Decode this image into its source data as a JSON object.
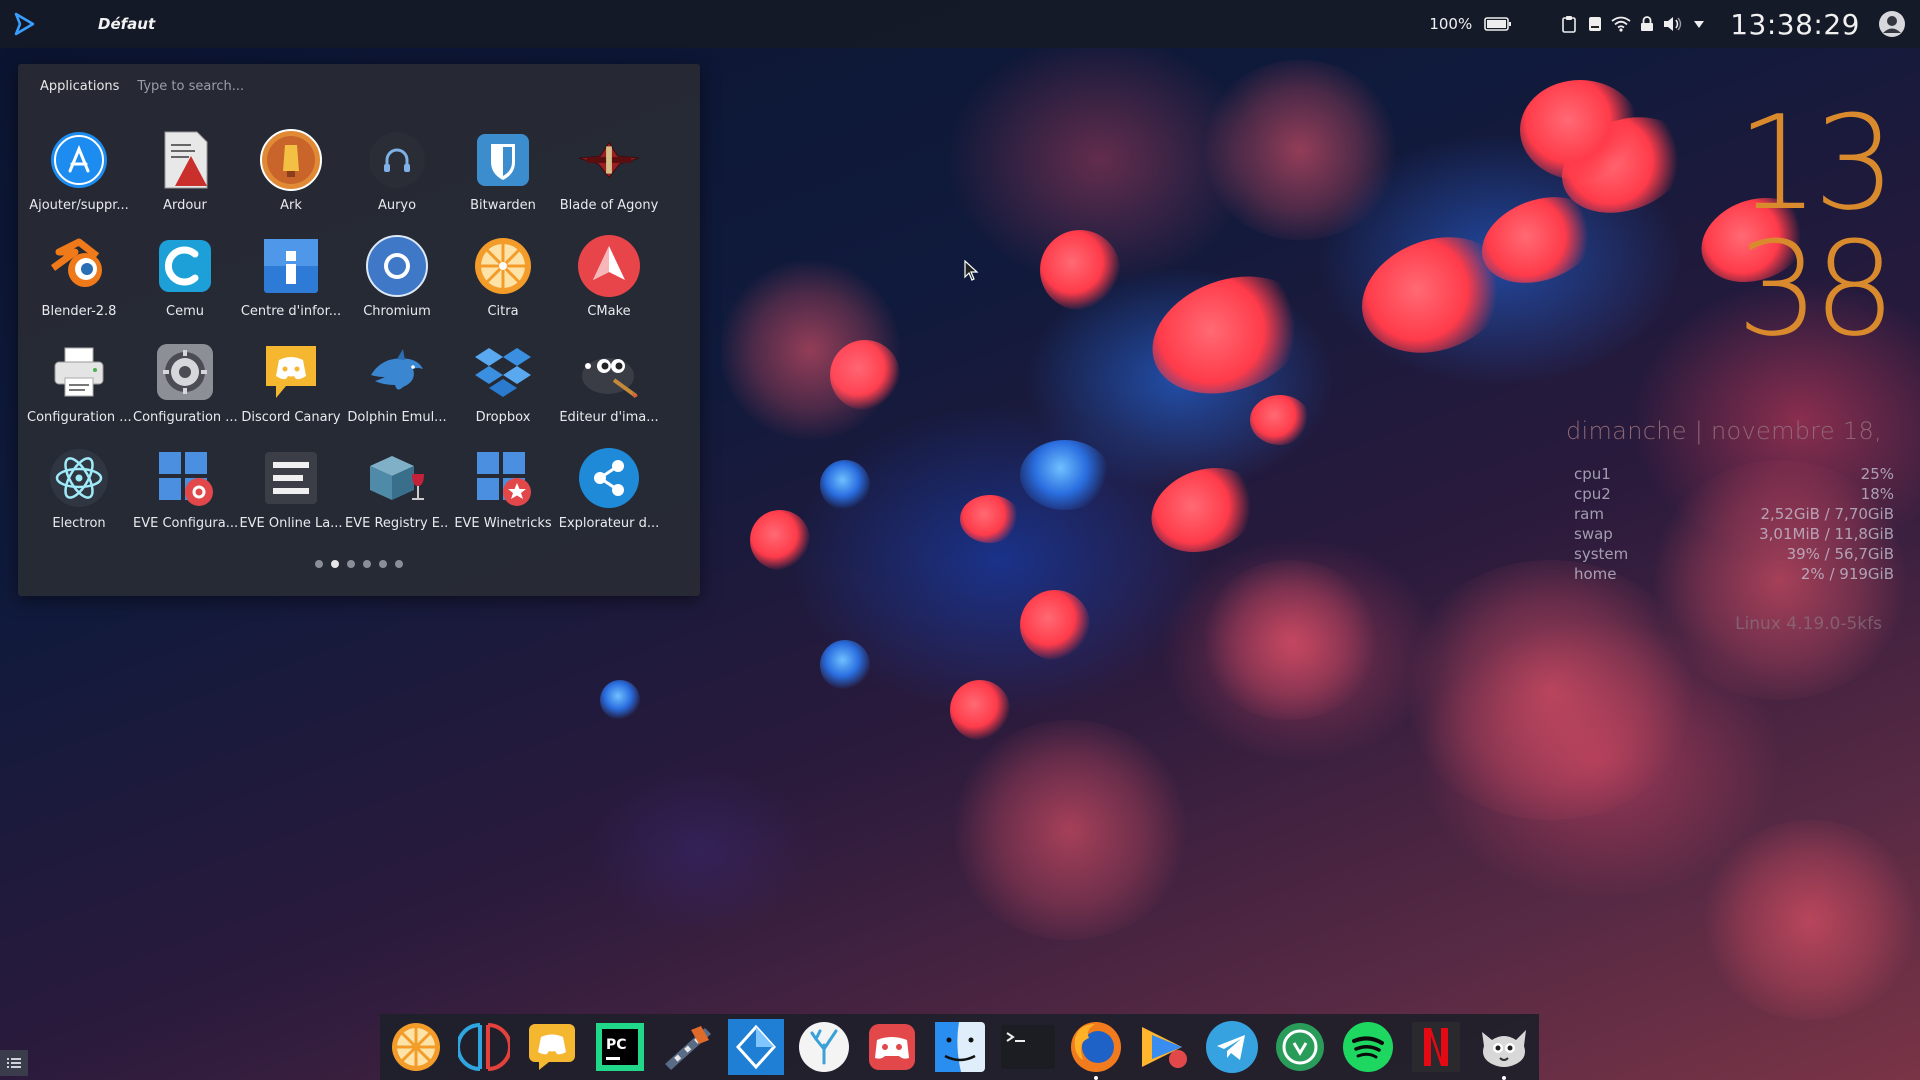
{
  "top_panel": {
    "activity_label": "Défaut",
    "battery_percent": "100%",
    "time": "13:38:29",
    "tray_icons": [
      "battery-icon",
      "clipboard-icon",
      "drive-icon",
      "wifi-icon",
      "lock-icon",
      "volume-icon",
      "tray-expand-icon"
    ]
  },
  "app_menu": {
    "tab_label": "Applications",
    "search_placeholder": "Type to search...",
    "apps": [
      {
        "label": "Ajouter/suppr...",
        "icon": "appstore-icon"
      },
      {
        "label": "Ardour",
        "icon": "ardour-icon"
      },
      {
        "label": "Ark",
        "icon": "ark-icon"
      },
      {
        "label": "Auryo",
        "icon": "auryo-icon"
      },
      {
        "label": "Bitwarden",
        "icon": "bitwarden-icon"
      },
      {
        "label": "Blade of Agony",
        "icon": "blade-of-agony-icon"
      },
      {
        "label": "Blender-2.8",
        "icon": "blender-icon"
      },
      {
        "label": "Cemu",
        "icon": "cemu-icon"
      },
      {
        "label": "Centre d'infor...",
        "icon": "info-center-icon"
      },
      {
        "label": "Chromium",
        "icon": "chromium-icon"
      },
      {
        "label": "Citra",
        "icon": "citra-icon"
      },
      {
        "label": "CMake",
        "icon": "cmake-icon"
      },
      {
        "label": "Configuration ...",
        "icon": "printer-icon"
      },
      {
        "label": "Configuration ...",
        "icon": "settings-icon"
      },
      {
        "label": "Discord Canary",
        "icon": "discord-canary-icon"
      },
      {
        "label": "Dolphin Emul...",
        "icon": "dolphin-icon"
      },
      {
        "label": "Dropbox",
        "icon": "dropbox-icon"
      },
      {
        "label": "Éditeur d'ima...",
        "icon": "gimp-icon"
      },
      {
        "label": "Electron",
        "icon": "electron-icon"
      },
      {
        "label": "EVE Configura...",
        "icon": "eve-config-icon"
      },
      {
        "label": "EVE Online La...",
        "icon": "eve-online-icon"
      },
      {
        "label": "EVE Registry E...",
        "icon": "eve-registry-icon"
      },
      {
        "label": "EVE Winetricks",
        "icon": "eve-winetricks-icon"
      },
      {
        "label": "Explorateur d...",
        "icon": "share-explorer-icon"
      }
    ],
    "pages": 6,
    "active_page": 1
  },
  "clock_widget": {
    "hours": "13",
    "minutes": "38",
    "date": "dimanche | novembre 18,",
    "accent": "#d98a2c"
  },
  "system_monitor": {
    "rows": [
      {
        "name": "cpu1",
        "value": "25%"
      },
      {
        "name": "cpu2",
        "value": "18%"
      },
      {
        "name": "ram",
        "value": "2,52GiB / 7,70GiB"
      },
      {
        "name": "swap",
        "value": "3,01MiB / 11,8GiB"
      },
      {
        "name": "system",
        "value": "39% / 56,7GiB"
      },
      {
        "name": "home",
        "value": "2% / 919GiB"
      }
    ],
    "kernel": "Linux 4.19.0-5kfs"
  },
  "dock": {
    "items": [
      {
        "icon": "citra-icon",
        "running": false
      },
      {
        "icon": "yuzu-icon",
        "running": false
      },
      {
        "icon": "discord-icon",
        "running": false
      },
      {
        "icon": "pycharm-icon",
        "running": false
      },
      {
        "icon": "video-editor-icon",
        "running": false
      },
      {
        "icon": "sublime-merge-icon",
        "running": false
      },
      {
        "icon": "coral-icon",
        "running": false
      },
      {
        "icon": "game-controller-icon",
        "running": false
      },
      {
        "icon": "finder-icon",
        "running": false
      },
      {
        "icon": "terminal-icon",
        "running": false
      },
      {
        "icon": "firefox-icon",
        "running": true
      },
      {
        "icon": "media-player-icon",
        "running": false
      },
      {
        "icon": "telegram-icon",
        "running": false
      },
      {
        "icon": "vpn-icon",
        "running": false
      },
      {
        "icon": "spotify-icon",
        "running": false
      },
      {
        "icon": "netflix-icon",
        "running": false
      },
      {
        "icon": "gimp-icon",
        "running": true
      }
    ]
  }
}
